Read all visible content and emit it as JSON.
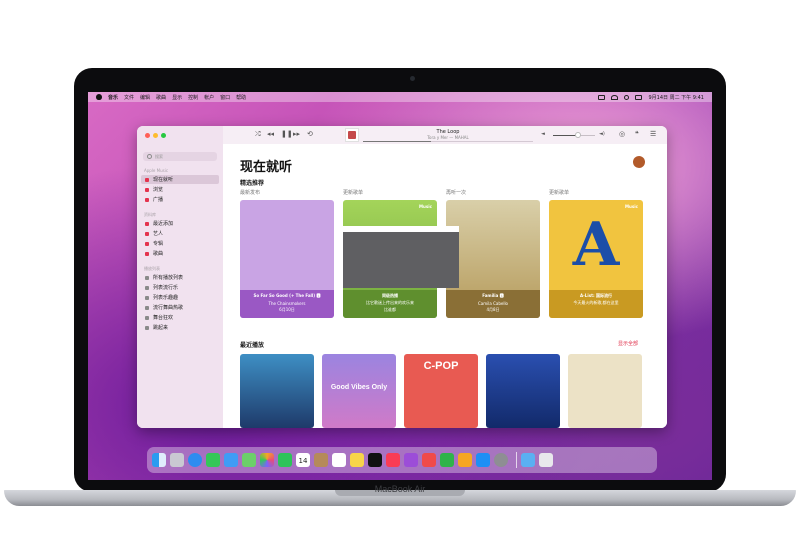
{
  "device": {
    "label": "MacBook Air"
  },
  "menubar": {
    "items": [
      "音乐",
      "文件",
      "编辑",
      "歌曲",
      "显示",
      "控制",
      "帐户",
      "窗口",
      "帮助"
    ],
    "clock": "9月14日 周二 下午 9:41"
  },
  "toolbar": {
    "now_playing_title": "The Loop",
    "now_playing_artist": "Tora y Mer — MAHAL",
    "progress": 0.4,
    "volume": 0.55
  },
  "sidebar": {
    "search_placeholder": "搜索",
    "sections": [
      {
        "title": "Apple Music",
        "items": [
          {
            "label": "现在就听",
            "selected": true
          },
          {
            "label": "浏览"
          },
          {
            "label": "广播"
          }
        ]
      },
      {
        "title": "资料库",
        "items": [
          {
            "label": "最近添加"
          },
          {
            "label": "艺人"
          },
          {
            "label": "专辑"
          },
          {
            "label": "歌曲"
          }
        ]
      },
      {
        "title": "播放列表",
        "items": [
          {
            "label": "所有播放列表"
          },
          {
            "label": "列表流行乐"
          },
          {
            "label": "列表乐趣趣"
          },
          {
            "label": "流行舞曲热歌"
          },
          {
            "label": "舞台狂欢"
          },
          {
            "label": "跳起来"
          }
        ]
      }
    ]
  },
  "main": {
    "title": "现在就听",
    "featured_heading": "精选推荐",
    "cards": [
      {
        "caption": "最新发布",
        "title": "So Far So Good (+ The Fall) 🅴",
        "subtitle": "The Chainsmokers",
        "date": "6月10日",
        "color": "#b06fd0"
      },
      {
        "caption": "更新歌单",
        "title": "同级热播",
        "subtitle": "比它歌迷上传出来的欢乐来",
        "date": "比谁都",
        "color": "#8cb43c"
      },
      {
        "caption": "再听一次",
        "title": "Familia 🅴",
        "subtitle": "Camila Cabello",
        "date": "4月8日",
        "color": "#a08840"
      },
      {
        "caption": "更新歌单",
        "title": "A-List: 国际流行",
        "subtitle": "今天最火的新歌,都在这里",
        "date": "",
        "color": "#e7b83a"
      }
    ],
    "apple_music_badge": "Music",
    "big_letter": "A",
    "recent_heading": "最近播放",
    "show_all": "显示全部",
    "recent": [
      {
        "label": "",
        "color": "#2f6fa3"
      },
      {
        "label": "Good Vibes Only",
        "color": "#7a5fc8"
      },
      {
        "label": "C-POP",
        "color": "#e04a4a"
      },
      {
        "label": "",
        "color": "#1f3f8f"
      },
      {
        "label": "",
        "color": "#e8dcc0"
      }
    ]
  },
  "dock": {
    "apps": [
      "finder-icon",
      "launchpad-icon",
      "safari-icon",
      "messages-icon",
      "mail-icon",
      "maps-icon",
      "photos-icon",
      "facetime-icon",
      "calendar-icon",
      "contacts-icon",
      "reminders-icon",
      "notes-icon",
      "tv-icon",
      "music-icon",
      "podcasts-icon",
      "news-icon",
      "numbers-icon",
      "pages-icon",
      "appstore-icon",
      "settings-icon",
      "folder-icon",
      "trash-icon"
    ],
    "calendar_day": "14"
  },
  "colors": {
    "accent": "#e0304a"
  }
}
